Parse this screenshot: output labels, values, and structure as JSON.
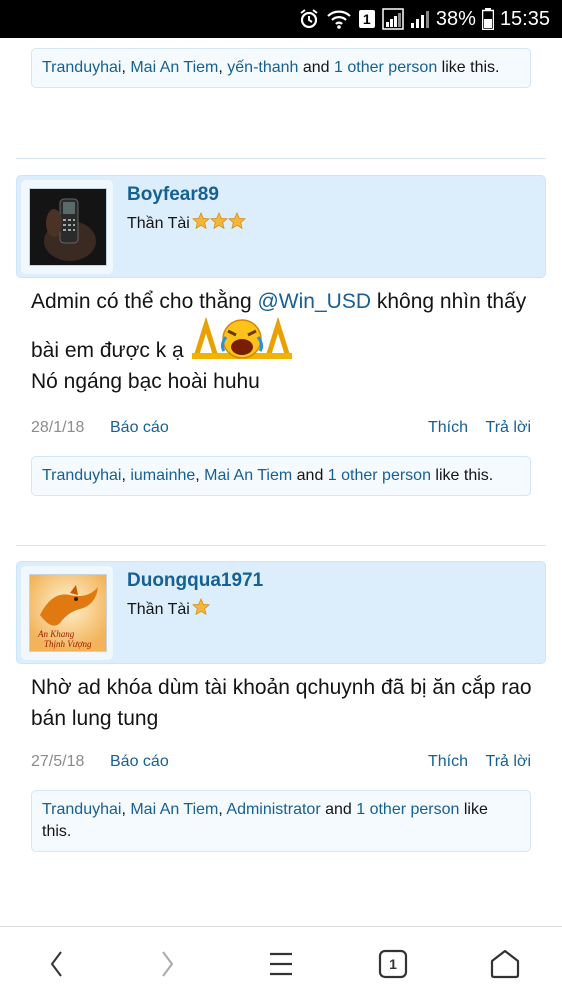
{
  "status_bar": {
    "battery_percent": "38%",
    "time": "15:35",
    "sim_badge": "1"
  },
  "post0": {
    "likes": {
      "names": [
        "Tranduyhai",
        "Mai An Tiem",
        "yến-thanh"
      ],
      "sep1": ", ",
      "sep2": ", ",
      "and": " and ",
      "others": "1 other person",
      "suffix": " like this."
    }
  },
  "post1": {
    "username": "Boyfear89",
    "user_title": "Thần Tài",
    "stars": 3,
    "message_prefix": "Admin có thể cho thằng ",
    "mention": "@Win_USD",
    "message_mid": " không nhìn thấy bài em được k ạ",
    "message_line2": "Nó ngáng bạc hoài huhu",
    "date": "28/1/18",
    "report_label": "Báo cáo",
    "like_label": "Thích",
    "reply_label": "Trả lời",
    "likes": {
      "names": [
        "Tranduyhai",
        "iumainhe",
        "Mai An Tiem"
      ],
      "sep1": ", ",
      "sep2": ", ",
      "and": " and ",
      "others": "1 other person",
      "suffix": " like this."
    }
  },
  "post2": {
    "username": "Duongqua1971",
    "user_title": "Thần Tài",
    "stars": 1,
    "message": "Nhờ ad khóa dùm tài khoản qchuynh đã bị ăn cắp rao bán lung tung",
    "date": "27/5/18",
    "report_label": "Báo cáo",
    "like_label": "Thích",
    "reply_label": "Trả lời",
    "likes": {
      "names": [
        "Tranduyhai",
        "Mai An Tiem",
        "Administrator"
      ],
      "sep1": ", ",
      "sep2": ", ",
      "and": " and ",
      "others": "1 other person",
      "suffix": " like this."
    }
  },
  "nav": {
    "tab_count": "1"
  },
  "colors": {
    "link": "#176093",
    "userbar_bg": "#dceefc",
    "likes_bg": "#f5fafe",
    "meta_gray": "#8c8c8c"
  }
}
